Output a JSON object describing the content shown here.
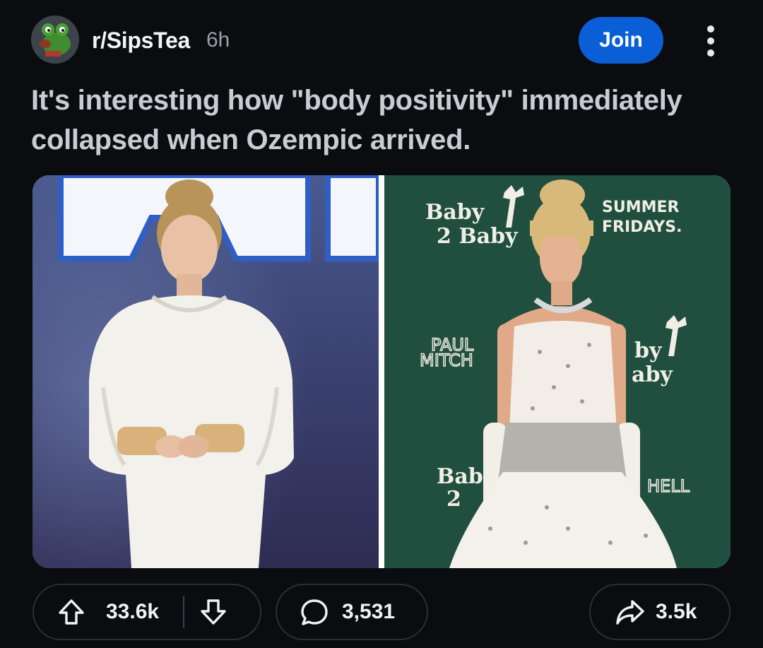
{
  "post": {
    "subreddit": "r/SipsTea",
    "time": "6h",
    "join_label": "Join",
    "title": "It's interesting how \"body positivity\" immediately collapsed when Ozempic arrived."
  },
  "media": {
    "left": {
      "backdrop_color": "#3d4a78"
    },
    "right": {
      "backdrop_color": "#1f4a3a",
      "signs": {
        "logo_line1": "Baby",
        "logo_line2": "2 Baby",
        "sponsor_line1": "SUMMER",
        "sponsor_line2": "FRIDAYS.",
        "paul_line1": "PAUL",
        "paul_line2": "MITCH",
        "partial_logo_line1": "by",
        "partial_logo_line2": "aby",
        "bottom_logo_line1": "Bab",
        "bottom_logo_line2": "2",
        "mitchell_partial": "HELL"
      }
    }
  },
  "actions": {
    "upvotes": "33.6k",
    "comments": "3,531",
    "shares": "3.5k"
  },
  "colors": {
    "background": "#0b0c0f",
    "join_button": "#0a5fd6",
    "title_text": "#c9ccd0"
  },
  "icons": {
    "upvote": "arrow-up-icon",
    "downvote": "arrow-down-icon",
    "comment": "speech-bubble-icon",
    "share": "share-arrow-icon",
    "more": "vertical-dots-icon"
  }
}
